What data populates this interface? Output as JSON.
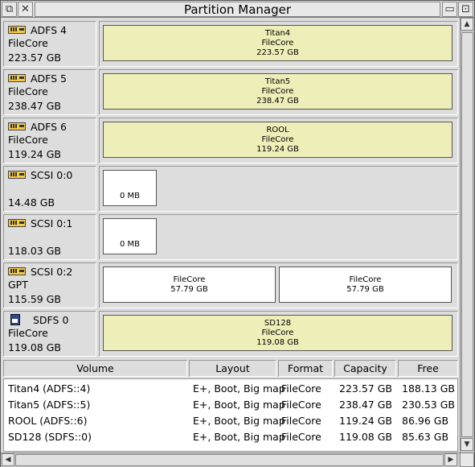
{
  "window": {
    "title": "Partition Manager",
    "back_icon": "back-icon",
    "close_icon": "close-icon",
    "iconise_icon": "iconise-icon",
    "toggle_size_icon": "toggle-size-icon"
  },
  "drives": [
    {
      "name": "ADFS 4",
      "icon": "hard-disc-icon",
      "scheme": "FileCore",
      "size": "223.57 GB",
      "partitions": [
        {
          "lines": [
            "Titan4",
            "FileCore",
            "223.57 GB"
          ],
          "used": true
        }
      ]
    },
    {
      "name": "ADFS 5",
      "icon": "hard-disc-icon",
      "scheme": "FileCore",
      "size": "238.47 GB",
      "partitions": [
        {
          "lines": [
            "Titan5",
            "FileCore",
            "238.47 GB"
          ],
          "used": true
        }
      ]
    },
    {
      "name": "ADFS 6",
      "icon": "hard-disc-icon",
      "scheme": "FileCore",
      "size": "119.24 GB",
      "partitions": [
        {
          "lines": [
            "ROOL",
            "FileCore",
            "119.24 GB"
          ],
          "used": true
        }
      ]
    },
    {
      "name": "SCSI 0:0",
      "icon": "hard-disc-icon",
      "scheme": "",
      "size": "14.48 GB",
      "partitions": [
        {
          "lines": [
            "0 MB"
          ],
          "used": false
        }
      ]
    },
    {
      "name": "SCSI 0:1",
      "icon": "hard-disc-icon",
      "scheme": "",
      "size": "118.03 GB",
      "partitions": [
        {
          "lines": [
            "0 MB"
          ],
          "used": false
        }
      ]
    },
    {
      "name": "SCSI 0:2",
      "icon": "hard-disc-icon",
      "scheme": "GPT",
      "size": "115.59 GB",
      "partitions": [
        {
          "lines": [
            "FileCore",
            "57.79 GB"
          ],
          "used": false
        },
        {
          "lines": [
            "FileCore",
            "57.79 GB"
          ],
          "used": false
        }
      ]
    },
    {
      "name": "SDFS 0",
      "icon": "sd-card-icon",
      "scheme": "FileCore",
      "size": "119.08 GB",
      "partitions": [
        {
          "lines": [
            "SD128",
            "FileCore",
            "119.08 GB"
          ],
          "used": true
        }
      ]
    }
  ],
  "table": {
    "headers": {
      "volume": "Volume",
      "layout": "Layout",
      "format": "Format",
      "capacity": "Capacity",
      "free": "Free"
    },
    "rows": [
      {
        "volume": "Titan4 (ADFS::4)",
        "layout": "E+, Boot, Big map",
        "format": "FileCore",
        "capacity": "223.57 GB",
        "free": "188.13 GB"
      },
      {
        "volume": "Titan5 (ADFS::5)",
        "layout": "E+, Boot, Big map",
        "format": "FileCore",
        "capacity": "238.47 GB",
        "free": "230.53 GB"
      },
      {
        "volume": "ROOL (ADFS::6)",
        "layout": "E+, Boot, Big map",
        "format": "FileCore",
        "capacity": "119.24 GB",
        "free": "86.96 GB"
      },
      {
        "volume": "SD128 (SDFS::0)",
        "layout": "E+, Boot, Big map",
        "format": "FileCore",
        "capacity": "119.08 GB",
        "free": "85.63 GB"
      }
    ]
  },
  "colors": {
    "used_partition": "#eeeeb8",
    "empty_partition": "#ffffff",
    "window_bg": "#dddddd",
    "disc_icon": "#f3c94a",
    "sd_icon": "#2a4a8a"
  }
}
